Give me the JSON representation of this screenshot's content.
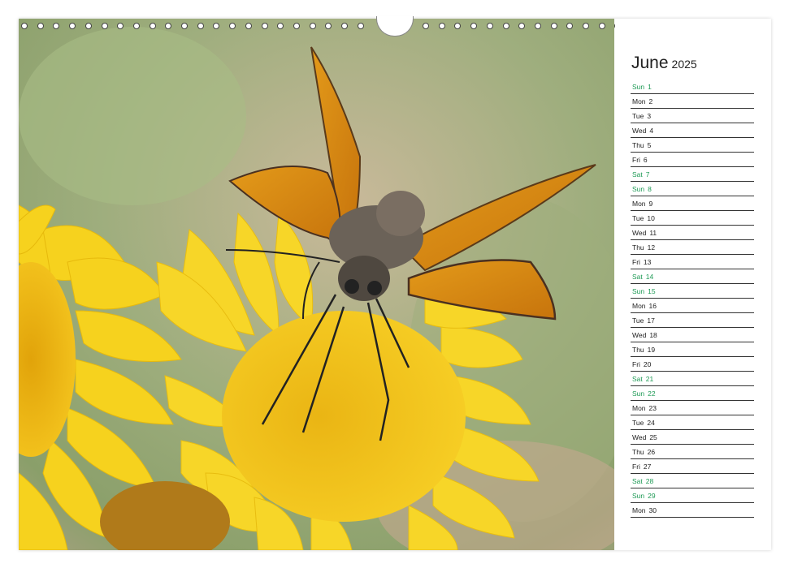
{
  "calendar": {
    "month": "June",
    "year": "2025",
    "days": [
      {
        "dow": "Sun",
        "num": "1",
        "weekend": true
      },
      {
        "dow": "Mon",
        "num": "2",
        "weekend": false
      },
      {
        "dow": "Tue",
        "num": "3",
        "weekend": false
      },
      {
        "dow": "Wed",
        "num": "4",
        "weekend": false
      },
      {
        "dow": "Thu",
        "num": "5",
        "weekend": false
      },
      {
        "dow": "Fri",
        "num": "6",
        "weekend": false
      },
      {
        "dow": "Sat",
        "num": "7",
        "weekend": true
      },
      {
        "dow": "Sun",
        "num": "8",
        "weekend": true
      },
      {
        "dow": "Mon",
        "num": "9",
        "weekend": false
      },
      {
        "dow": "Tue",
        "num": "10",
        "weekend": false
      },
      {
        "dow": "Wed",
        "num": "11",
        "weekend": false
      },
      {
        "dow": "Thu",
        "num": "12",
        "weekend": false
      },
      {
        "dow": "Fri",
        "num": "13",
        "weekend": false
      },
      {
        "dow": "Sat",
        "num": "14",
        "weekend": true
      },
      {
        "dow": "Sun",
        "num": "15",
        "weekend": true
      },
      {
        "dow": "Mon",
        "num": "16",
        "weekend": false
      },
      {
        "dow": "Tue",
        "num": "17",
        "weekend": false
      },
      {
        "dow": "Wed",
        "num": "18",
        "weekend": false
      },
      {
        "dow": "Thu",
        "num": "19",
        "weekend": false
      },
      {
        "dow": "Fri",
        "num": "20",
        "weekend": false
      },
      {
        "dow": "Sat",
        "num": "21",
        "weekend": true
      },
      {
        "dow": "Sun",
        "num": "22",
        "weekend": true
      },
      {
        "dow": "Mon",
        "num": "23",
        "weekend": false
      },
      {
        "dow": "Tue",
        "num": "24",
        "weekend": false
      },
      {
        "dow": "Wed",
        "num": "25",
        "weekend": false
      },
      {
        "dow": "Thu",
        "num": "26",
        "weekend": false
      },
      {
        "dow": "Fri",
        "num": "27",
        "weekend": false
      },
      {
        "dow": "Sat",
        "num": "28",
        "weekend": true
      },
      {
        "dow": "Sun",
        "num": "29",
        "weekend": true
      },
      {
        "dow": "Mon",
        "num": "30",
        "weekend": false
      }
    ]
  },
  "colors": {
    "weekend": "#1e9a55",
    "weekday": "#222222",
    "flower": "#f5cf1a",
    "wing": "#d98a12"
  },
  "photo": {
    "subject_icon": "butterfly-on-flower-photo"
  }
}
